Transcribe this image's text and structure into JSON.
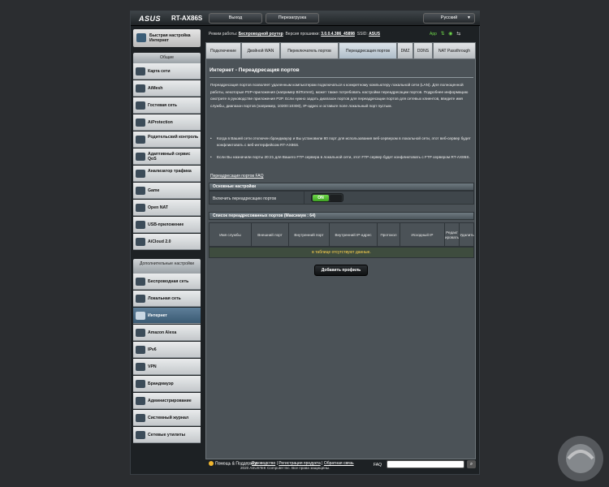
{
  "header": {
    "logo": "ASUS",
    "model": "RT-AX86S",
    "logout_label": "Выход",
    "reboot_label": "Перезагрузка",
    "language": "Русский"
  },
  "status": {
    "mode_label": "Режим работы:",
    "mode_value": "Беспроводной роутер",
    "firmware_label": "Версия прошивки:",
    "firmware_value": "3.0.0.4.386_45898",
    "ssid_label": "SSID:",
    "ssid_value": "ASUS",
    "app_label": "App"
  },
  "sidebar": {
    "quick_setup": "Быстрая настройка Интернет",
    "general_header": "Общие",
    "general_items": [
      {
        "label": "Карта сети",
        "icon": "network-map-icon"
      },
      {
        "label": "AiMesh",
        "icon": "aimesh-icon"
      },
      {
        "label": "Гостевая сеть",
        "icon": "guest-network-icon"
      },
      {
        "label": "AiProtection",
        "icon": "shield-icon"
      },
      {
        "label": "Родительский контроль",
        "icon": "parental-control-icon"
      },
      {
        "label": "Адаптивный сервис QoS",
        "icon": "qos-icon"
      },
      {
        "label": "Анализатор трафика",
        "icon": "traffic-analyzer-icon"
      },
      {
        "label": "Game",
        "icon": "gamepad-icon"
      },
      {
        "label": "Open NAT",
        "icon": "open-nat-icon"
      },
      {
        "label": "USB-приложение",
        "icon": "usb-icon"
      },
      {
        "label": "AiCloud 2.0",
        "icon": "cloud-icon"
      }
    ],
    "advanced_header": "Дополнительные настройки",
    "advanced_items": [
      {
        "label": "Беспроводная сеть",
        "icon": "wireless-icon"
      },
      {
        "label": "Локальная сеть",
        "icon": "lan-icon"
      },
      {
        "label": "Интернет",
        "icon": "globe-icon"
      },
      {
        "label": "Amazon Alexa",
        "icon": "alexa-icon"
      },
      {
        "label": "IPv6",
        "icon": "ipv6-icon"
      },
      {
        "label": "VPN",
        "icon": "vpn-icon"
      },
      {
        "label": "Брандмауэр",
        "icon": "firewall-icon"
      },
      {
        "label": "Администрирование",
        "icon": "admin-icon"
      },
      {
        "label": "Системный журнал",
        "icon": "system-log-icon"
      },
      {
        "label": "Сетевые утилиты",
        "icon": "network-tools-icon"
      }
    ]
  },
  "tabs": [
    {
      "label": "Подключение"
    },
    {
      "label": "Двойной WAN"
    },
    {
      "label": "Переключатель портов"
    },
    {
      "label": "Переадресация портов"
    },
    {
      "label": "DMZ"
    },
    {
      "label": "DDNS"
    },
    {
      "label": "NAT Passthrough"
    }
  ],
  "page": {
    "title": "Интернет - Переадресация портов",
    "description": "Переадресация портов позволяет удаленным компьютерам подключаться к конкретному компьютеру локальной сети (LAN). Для полноценной работы, некоторые P2P-приложения (например BitTorrent), может также потребовать настройки переадресации портов. Подробнее информацию смотрите в руководстве приложения P2P. Если нужно задать диапазон портов для переадресации портов для сетевых клиентов, введите имя службы, диапазон портов (например, 10200:10300), IP-адрес и оставьте поле локальный порт пустым.",
    "bullets": [
      "Когда в Вашей сети отключен брандмауэр и Вы установили 80 порт для использования веб-сервером в локальной сети, этот веб-сервер будет конфликтовать с веб-интерфейсом RT-AX86S.",
      "Если Вы назначили порты 20:21 для Вашего FTP сервера в локальной сети, этот FTP сервер будет конфликтовать с FTP сервером RT-AX86S."
    ],
    "faq_link": "Переадресация портов FAQ",
    "basic_header": "Основные настройки",
    "enable_label": "Включить переадресацию портов",
    "toggle_on": "ON",
    "list_header": "Список переадресованных портов (Максимум : 64)",
    "columns": [
      "Имя службы",
      "Внешний порт",
      "Внутренний порт",
      "Внутренний IP-адрес",
      "Протокол",
      "Исходный IP",
      "Редактировать",
      "Удалить"
    ],
    "empty_text": "в таблице отсутствуют данные.",
    "add_profile": "Добавить профиль"
  },
  "footer": {
    "help": "Помощь & Поддержка",
    "manual": "Руководство",
    "register": "Регистрация продукта",
    "feedback": "Обратная связь",
    "faq": "FAQ",
    "copyright": "2020 ASUSTeK Computer Inc. Все права защищены."
  },
  "colors": {
    "accent": "#3a5a73",
    "toggle_on": "#4cb82e",
    "empty_text": "#ffd24d"
  }
}
